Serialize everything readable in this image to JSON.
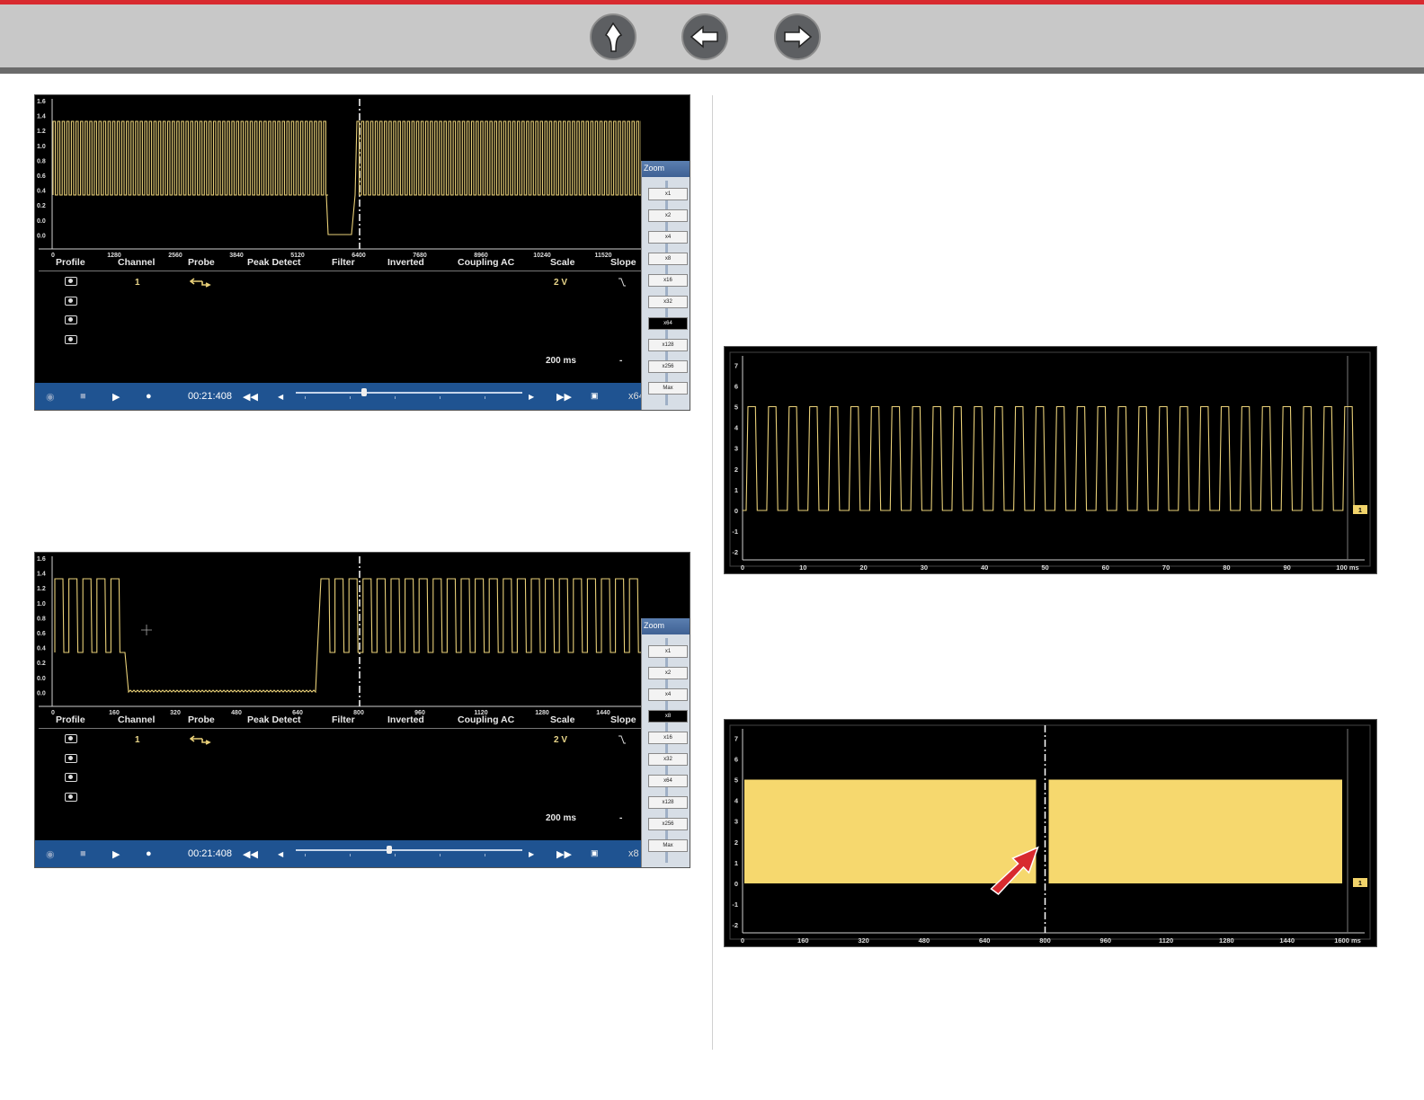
{
  "nav": {
    "buttons": [
      "up",
      "back",
      "forward"
    ]
  },
  "scope1": {
    "y_ticks": [
      "1.6",
      "1.4",
      "1.2",
      "1.0",
      "0.8",
      "0.6",
      "0.4",
      "0.2",
      "0.0",
      "0.0"
    ],
    "x_ticks": [
      "0",
      "1280",
      "2560",
      "3840",
      "5120",
      "6400",
      "7680",
      "8960",
      "10240",
      "11520"
    ],
    "headers": [
      "Profile",
      "Channel",
      "Probe",
      "Peak Detect",
      "Filter",
      "Inverted",
      "Coupling AC",
      "Scale",
      "Slope"
    ],
    "channel": "1",
    "scale": "2 V",
    "timebase": "200 ms",
    "dash": "-",
    "time": "00:21:408",
    "zoom_label": "x64",
    "zoom_title": "Zoom",
    "zoom_options": [
      "x1",
      "x2",
      "x4",
      "x8",
      "x16",
      "x32",
      "x64",
      "x128",
      "x256",
      "Max"
    ],
    "zoom_selected": "x64",
    "scroll_position": 0.29
  },
  "scope2": {
    "y_ticks": [
      "1.6",
      "1.4",
      "1.2",
      "1.0",
      "0.8",
      "0.6",
      "0.4",
      "0.2",
      "0.0",
      "0.0"
    ],
    "x_ticks": [
      "0",
      "160",
      "320",
      "480",
      "640",
      "800",
      "960",
      "1120",
      "1280",
      "1440"
    ],
    "headers": [
      "Profile",
      "Channel",
      "Probe",
      "Peak Detect",
      "Filter",
      "Inverted",
      "Coupling AC",
      "Scale",
      "Slope"
    ],
    "channel": "1",
    "scale": "2 V",
    "timebase": "200 ms",
    "dash": "-",
    "time": "00:21:408",
    "zoom_label": "x8",
    "zoom_title": "Zoom",
    "zoom_options": [
      "x1",
      "x2",
      "x4",
      "x8",
      "x16",
      "x32",
      "x64",
      "x128",
      "x256",
      "Max"
    ],
    "zoom_selected": "x8",
    "scroll_position": 0.4
  },
  "plot1": {
    "y_ticks": [
      "7",
      "6",
      "5",
      "4",
      "3",
      "2",
      "1",
      "0",
      "-1",
      "-2"
    ],
    "x_ticks": [
      "0",
      "10",
      "20",
      "30",
      "40",
      "50",
      "60",
      "70",
      "80",
      "90",
      "100 ms"
    ],
    "marker": "1"
  },
  "plot2": {
    "y_ticks": [
      "7",
      "6",
      "5",
      "4",
      "3",
      "2",
      "1",
      "0",
      "-1",
      "-2"
    ],
    "x_ticks": [
      "0",
      "160",
      "320",
      "480",
      "640",
      "800",
      "960",
      "1120",
      "1280",
      "1440",
      "1600 ms"
    ],
    "marker": "1"
  },
  "colors": {
    "trace": "#e9d078",
    "fill": "#f6d86e",
    "brand_red": "#d82a2f",
    "control_bar": "#1f5391"
  }
}
